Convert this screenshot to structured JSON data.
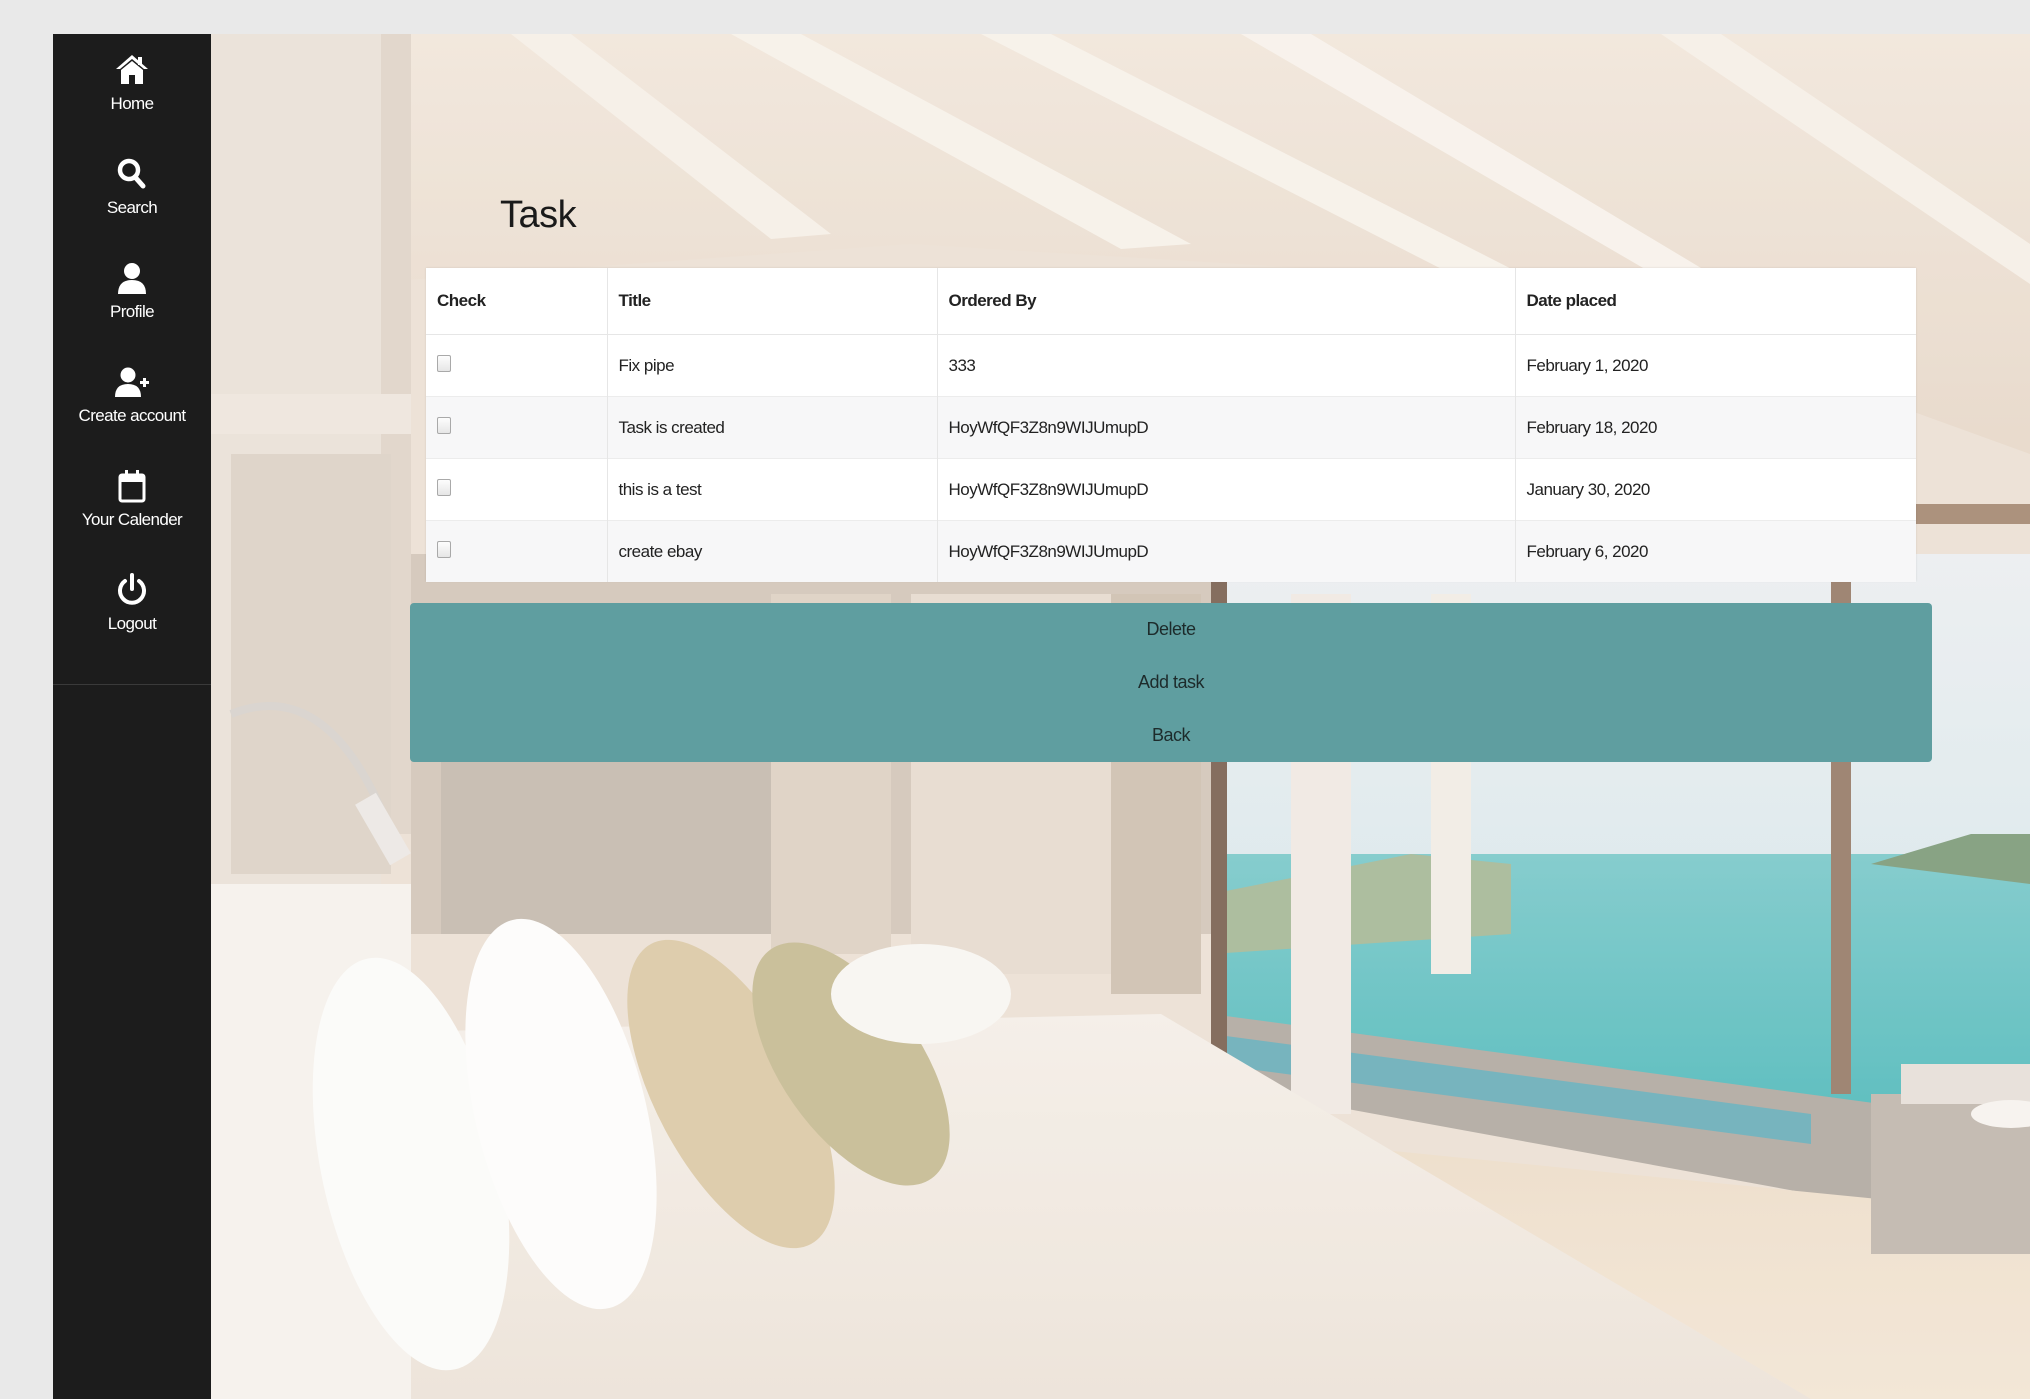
{
  "sidebar": {
    "items": [
      {
        "label": "Home",
        "icon": "home-icon"
      },
      {
        "label": "Search",
        "icon": "search-icon"
      },
      {
        "label": "Profile",
        "icon": "user-icon"
      },
      {
        "label": "Create account",
        "icon": "add-user-icon"
      },
      {
        "label": "Your Calender",
        "icon": "calendar-icon"
      },
      {
        "label": "Logout",
        "icon": "power-icon"
      }
    ]
  },
  "main": {
    "title": "Task",
    "table": {
      "headers": [
        "Check",
        "Title",
        "Ordered By",
        "Date placed"
      ],
      "rows": [
        {
          "checked": false,
          "title": "Fix pipe",
          "ordered_by": "333",
          "date": "February 1, 2020"
        },
        {
          "checked": false,
          "title": "Task is created",
          "ordered_by": "HoyWfQF3Z8n9WIJUmupD",
          "date": "February 18, 2020"
        },
        {
          "checked": false,
          "title": "this is a test",
          "ordered_by": "HoyWfQF3Z8n9WIJUmupD",
          "date": "January 30, 2020"
        },
        {
          "checked": false,
          "title": "create ebay",
          "ordered_by": "HoyWfQF3Z8n9WIJUmupD",
          "date": "February 6, 2020"
        }
      ]
    },
    "buttons": {
      "delete_label": "Delete",
      "add_label": "Add task",
      "back_label": "Back"
    }
  },
  "colors": {
    "sidebar_bg": "#1c1c1c",
    "button_bg": "#5f9ea0",
    "page_bg": "#e9e9e9"
  }
}
